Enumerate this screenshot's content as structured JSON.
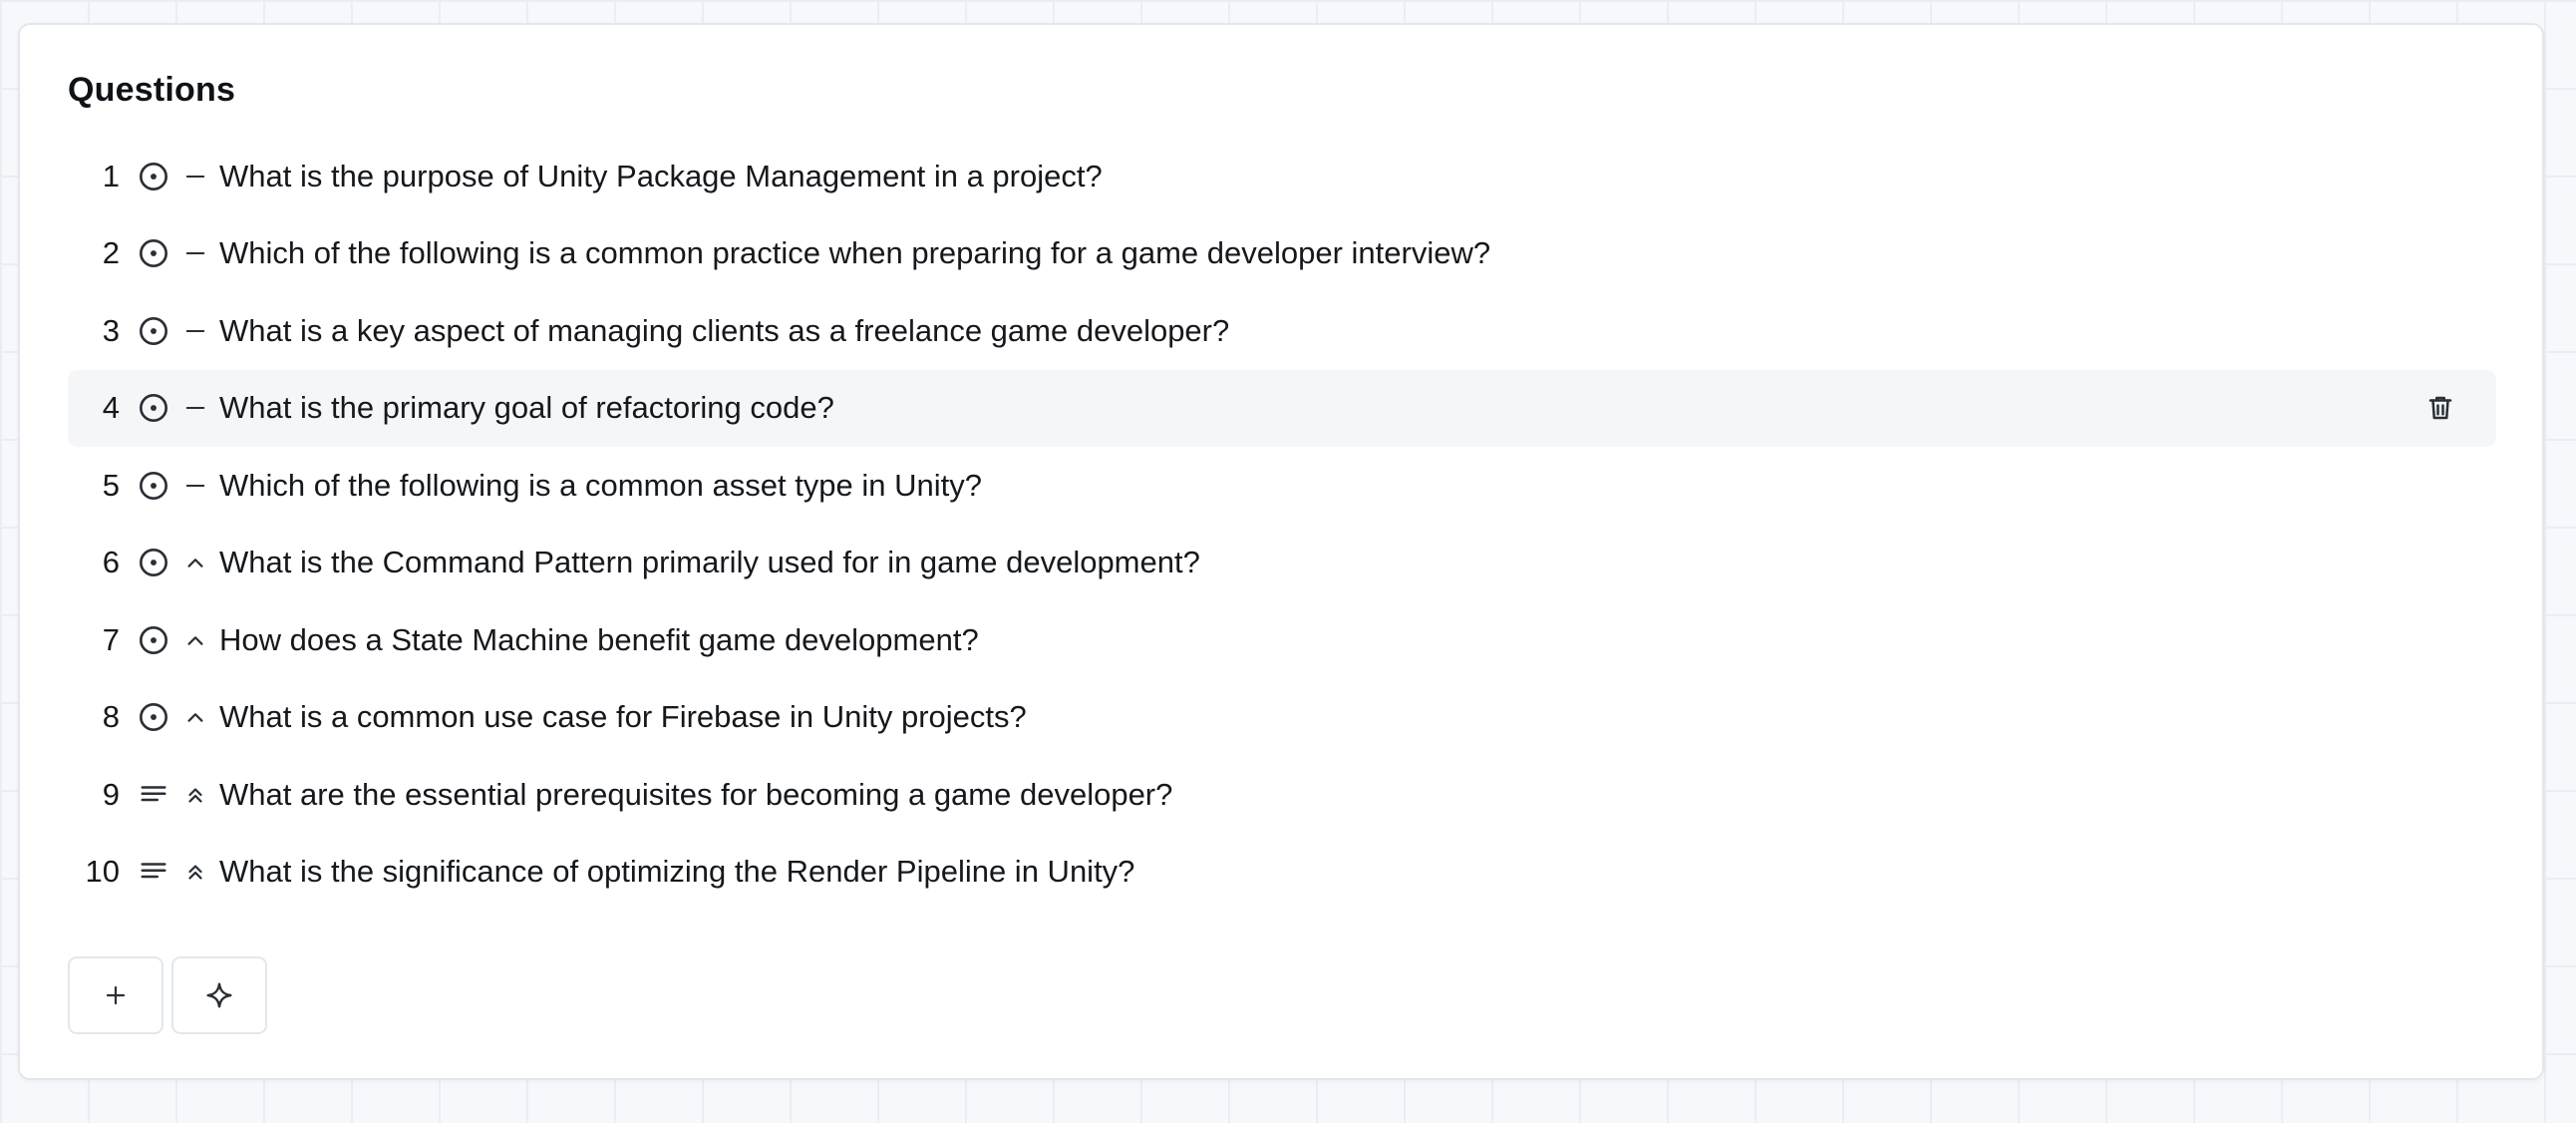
{
  "panel": {
    "title": "Questions"
  },
  "questions": [
    {
      "number": "1",
      "type_icon": "radio-circle-icon",
      "level_icon": "dash-icon",
      "text": "What is the purpose of Unity Package Management in a project?"
    },
    {
      "number": "2",
      "type_icon": "radio-circle-icon",
      "level_icon": "dash-icon",
      "text": "Which of the following is a common practice when preparing for a game developer interview?"
    },
    {
      "number": "3",
      "type_icon": "radio-circle-icon",
      "level_icon": "dash-icon",
      "text": "What is a key aspect of managing clients as a freelance game developer?"
    },
    {
      "number": "4",
      "type_icon": "radio-circle-icon",
      "level_icon": "dash-icon",
      "text": "What is the primary goal of refactoring code?",
      "hovered": true
    },
    {
      "number": "5",
      "type_icon": "radio-circle-icon",
      "level_icon": "dash-icon",
      "text": "Which of the following is a common asset type in Unity?"
    },
    {
      "number": "6",
      "type_icon": "radio-circle-icon",
      "level_icon": "chevron-up-icon",
      "text": "What is the Command Pattern primarily used for in game development?"
    },
    {
      "number": "7",
      "type_icon": "radio-circle-icon",
      "level_icon": "chevron-up-icon",
      "text": "How does a State Machine benefit game development?"
    },
    {
      "number": "8",
      "type_icon": "radio-circle-icon",
      "level_icon": "chevron-up-icon",
      "text": "What is a common use case for Firebase in Unity projects?"
    },
    {
      "number": "9",
      "type_icon": "text-lines-icon",
      "level_icon": "double-chevron-up-icon",
      "text": "What are the essential prerequisites for becoming a game developer?"
    },
    {
      "number": "10",
      "type_icon": "text-lines-icon",
      "level_icon": "double-chevron-up-icon",
      "text": "What is the significance of optimizing the Render Pipeline in Unity?"
    }
  ],
  "row_actions": {
    "delete_icon": "trash-icon"
  },
  "actions": {
    "add_icon": "plus-icon",
    "generate_icon": "sparkle-icon"
  },
  "colors": {
    "icon": "#2a2f36",
    "border": "#e3e7ed",
    "row_highlight": "#f4f6f8"
  }
}
